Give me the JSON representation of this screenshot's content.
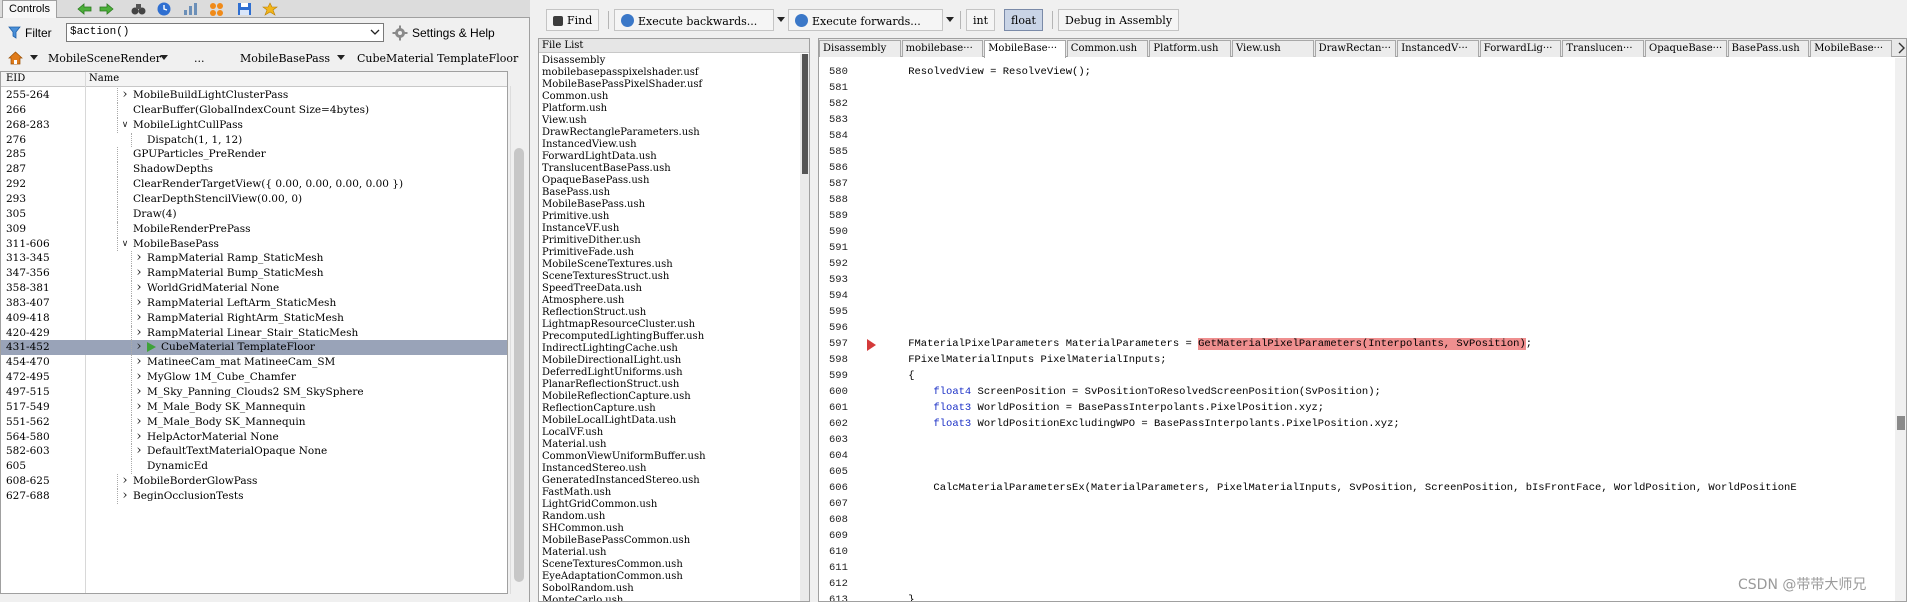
{
  "left_panel": {
    "tab_label": "Controls",
    "filter_label": "Filter",
    "filter_value": "$action()",
    "settings_label": "Settings & Help",
    "breadcrumb": [
      "MobileSceneRender",
      "...",
      "MobileBasePass",
      "CubeMaterial TemplateFloor"
    ],
    "columns": {
      "eid": "EID",
      "name": "Name"
    },
    "rows": [
      {
        "eid": "255-264",
        "name": "MobileBuildLightClusterPass",
        "depth": 1,
        "toggle": "collapsed"
      },
      {
        "eid": "266",
        "name": "ClearBuffer(GlobalIndexCount Size=4bytes)",
        "depth": 1,
        "toggle": "none"
      },
      {
        "eid": "268-283",
        "name": "MobileLightCullPass",
        "depth": 1,
        "toggle": "expanded"
      },
      {
        "eid": "276",
        "name": "Dispatch(1, 1, 12)",
        "depth": 2,
        "toggle": "none"
      },
      {
        "eid": "285",
        "name": "GPUParticles_PreRender",
        "depth": 1,
        "toggle": "none"
      },
      {
        "eid": "287",
        "name": "ShadowDepths",
        "depth": 1,
        "toggle": "none"
      },
      {
        "eid": "292",
        "name": "ClearRenderTargetView({ 0.00, 0.00, 0.00, 0.00 })",
        "depth": 1,
        "toggle": "none"
      },
      {
        "eid": "293",
        "name": "ClearDepthStencilView(0.00, 0)",
        "depth": 1,
        "toggle": "none"
      },
      {
        "eid": "305",
        "name": "Draw(4)",
        "depth": 1,
        "toggle": "none"
      },
      {
        "eid": "309",
        "name": "MobileRenderPrePass",
        "depth": 1,
        "toggle": "none"
      },
      {
        "eid": "311-606",
        "name": "MobileBasePass",
        "depth": 1,
        "toggle": "expanded"
      },
      {
        "eid": "313-345",
        "name": "RampMaterial Ramp_StaticMesh",
        "depth": 2,
        "toggle": "collapsed"
      },
      {
        "eid": "347-356",
        "name": "RampMaterial Bump_StaticMesh",
        "depth": 2,
        "toggle": "collapsed"
      },
      {
        "eid": "358-381",
        "name": "WorldGridMaterial None",
        "depth": 2,
        "toggle": "collapsed"
      },
      {
        "eid": "383-407",
        "name": "RampMaterial LeftArm_StaticMesh",
        "depth": 2,
        "toggle": "collapsed"
      },
      {
        "eid": "409-418",
        "name": "RampMaterial RightArm_StaticMesh",
        "depth": 2,
        "toggle": "collapsed"
      },
      {
        "eid": "420-429",
        "name": "RampMaterial Linear_Stair_StaticMesh",
        "depth": 2,
        "toggle": "collapsed"
      },
      {
        "eid": "431-452",
        "name": "CubeMaterial TemplateFloor",
        "depth": 2,
        "toggle": "collapsed",
        "selected": true
      },
      {
        "eid": "454-470",
        "name": "MatineeCam_mat MatineeCam_SM",
        "depth": 2,
        "toggle": "collapsed"
      },
      {
        "eid": "472-495",
        "name": "MyGlow 1M_Cube_Chamfer",
        "depth": 2,
        "toggle": "collapsed"
      },
      {
        "eid": "497-515",
        "name": "M_Sky_Panning_Clouds2 SM_SkySphere",
        "depth": 2,
        "toggle": "collapsed"
      },
      {
        "eid": "517-549",
        "name": "M_Male_Body SK_Mannequin",
        "depth": 2,
        "toggle": "collapsed"
      },
      {
        "eid": "551-562",
        "name": "M_Male_Body SK_Mannequin",
        "depth": 2,
        "toggle": "collapsed"
      },
      {
        "eid": "564-580",
        "name": "HelpActorMaterial None",
        "depth": 2,
        "toggle": "collapsed"
      },
      {
        "eid": "582-603",
        "name": "DefaultTextMaterialOpaque None",
        "depth": 2,
        "toggle": "collapsed"
      },
      {
        "eid": "605",
        "name": "DynamicEd",
        "depth": 2,
        "toggle": "none"
      },
      {
        "eid": "608-625",
        "name": "MobileBorderGlowPass",
        "depth": 1,
        "toggle": "collapsed"
      },
      {
        "eid": "627-688",
        "name": "BeginOcclusionTests",
        "depth": 1,
        "toggle": "collapsed"
      }
    ]
  },
  "toolbar": {
    "find_label": "Find",
    "exec_backwards_label": "Execute backwards...",
    "exec_forwards_label": "Execute forwards...",
    "int_label": "int",
    "float_label": "float",
    "debug_label": "Debug in Assembly"
  },
  "file_list": {
    "title": "File List",
    "items": [
      "Disassembly",
      "mobilebasepasspixelshader.usf",
      "MobileBasePassPixelShader.usf",
      "Common.ush",
      "Platform.ush",
      "View.ush",
      "DrawRectangleParameters.ush",
      "InstancedView.ush",
      "ForwardLightData.ush",
      "TranslucentBasePass.ush",
      "OpaqueBasePass.ush",
      "BasePass.ush",
      "MobileBasePass.ush",
      "Primitive.ush",
      "InstanceVF.ush",
      "PrimitiveDither.ush",
      "PrimitiveFade.ush",
      "MobileSceneTextures.ush",
      "SceneTexturesStruct.ush",
      "SpeedTreeData.ush",
      "Atmosphere.ush",
      "ReflectionStruct.ush",
      "LightmapResourceCluster.ush",
      "PrecomputedLightingBuffer.ush",
      "IndirectLightingCache.ush",
      "MobileDirectionalLight.ush",
      "DeferredLightUniforms.ush",
      "PlanarReflectionStruct.ush",
      "MobileReflectionCapture.ush",
      "ReflectionCapture.ush",
      "MobileLocalLightData.ush",
      "LocalVF.ush",
      "Material.ush",
      "CommonViewUniformBuffer.ush",
      "InstancedStereo.ush",
      "GeneratedInstancedStereo.ush",
      "FastMath.ush",
      "LightGridCommon.ush",
      "Random.ush",
      "SHCommon.ush",
      "MobileBasePassCommon.ush",
      "Material.ush",
      "SceneTexturesCommon.ush",
      "EyeAdaptationCommon.ush",
      "SobolRandom.ush",
      "MonteCarlo.ush"
    ]
  },
  "code_tabs": [
    "Disassembly",
    "mobilebase···",
    "MobileBase···",
    "Common.ush",
    "Platform.ush",
    "View.ush",
    "DrawRectan···",
    "InstancedV···",
    "ForwardLig···",
    "Translucen···",
    "OpaqueBase···",
    "BasePass.ush",
    "MobileBase···"
  ],
  "active_code_tab": 2,
  "code": {
    "lines": [
      {
        "n": "580",
        "text": "    ResolvedView = ResolveView();"
      },
      {
        "n": "581",
        "text": ""
      },
      {
        "n": "582",
        "text": ""
      },
      {
        "n": "583",
        "text": ""
      },
      {
        "n": "584",
        "text": ""
      },
      {
        "n": "585",
        "text": ""
      },
      {
        "n": "586",
        "text": ""
      },
      {
        "n": "587",
        "text": ""
      },
      {
        "n": "588",
        "text": ""
      },
      {
        "n": "589",
        "text": ""
      },
      {
        "n": "590",
        "text": ""
      },
      {
        "n": "591",
        "text": ""
      },
      {
        "n": "592",
        "text": ""
      },
      {
        "n": "593",
        "text": ""
      },
      {
        "n": "594",
        "text": ""
      },
      {
        "n": "595",
        "text": ""
      },
      {
        "n": "596",
        "text": ""
      },
      {
        "n": "597",
        "text": "    FMaterialPixelParameters MaterialParameters = ",
        "hl": "GetMaterialPixelParameters(Interpolants, SvPosition)",
        "tail": ";",
        "current": true
      },
      {
        "n": "598",
        "text": "    FPixelMaterialInputs PixelMaterialInputs;"
      },
      {
        "n": "599",
        "text": "    {"
      },
      {
        "n": "600",
        "kw": "float4",
        "text": " ScreenPosition = SvPositionToResolvedScreenPosition(SvPosition);",
        "indent": "        "
      },
      {
        "n": "601",
        "kw": "float3",
        "text": " WorldPosition = BasePassInterpolants.PixelPosition.xyz;",
        "indent": "        "
      },
      {
        "n": "602",
        "kw": "float3",
        "text": " WorldPositionExcludingWPO = BasePassInterpolants.PixelPosition.xyz;",
        "indent": "        "
      },
      {
        "n": "603",
        "text": ""
      },
      {
        "n": "604",
        "text": ""
      },
      {
        "n": "605",
        "text": ""
      },
      {
        "n": "606",
        "text": "        CalcMaterialParametersEx(MaterialParameters, PixelMaterialInputs, SvPosition, ScreenPosition, bIsFrontFace, WorldPosition, WorldPositionE"
      },
      {
        "n": "607",
        "text": ""
      },
      {
        "n": "608",
        "text": ""
      },
      {
        "n": "609",
        "text": ""
      },
      {
        "n": "610",
        "text": ""
      },
      {
        "n": "611",
        "text": ""
      },
      {
        "n": "612",
        "text": ""
      },
      {
        "n": "613",
        "text": "    }"
      }
    ]
  },
  "watermark": "CSDN @带带大师兄",
  "colors": {
    "selected_row": "#99a3b8",
    "highlight": "#ef8f8f",
    "keyword": "#1a2fc6",
    "current_line_marker": "#d43a3a"
  }
}
